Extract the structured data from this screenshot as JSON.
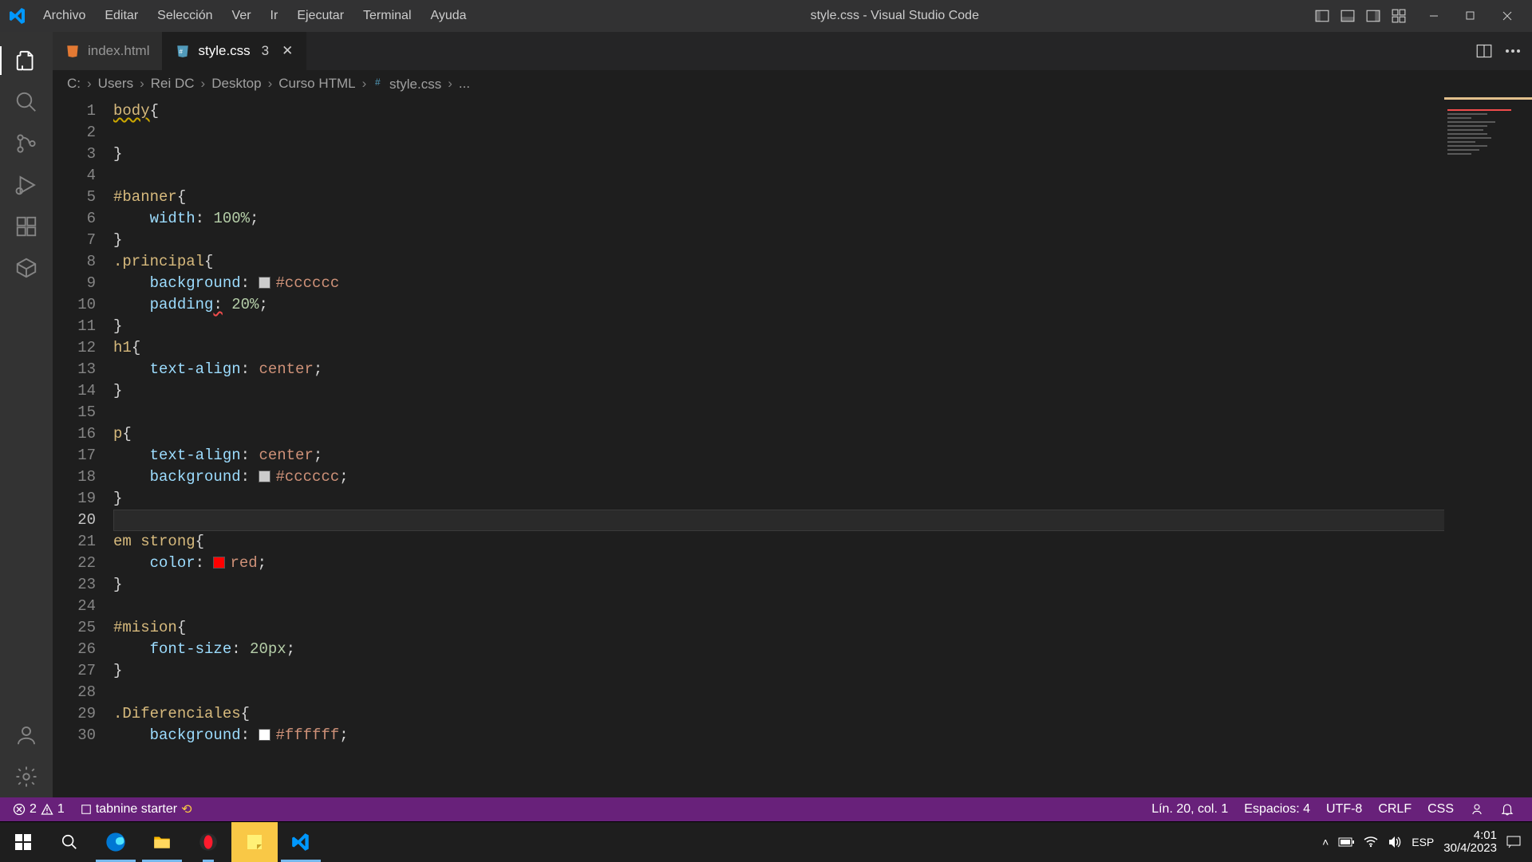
{
  "title_bar": {
    "menus": [
      "Archivo",
      "Editar",
      "Selección",
      "Ver",
      "Ir",
      "Ejecutar",
      "Terminal",
      "Ayuda"
    ],
    "title": "style.css - Visual Studio Code"
  },
  "tabs": [
    {
      "name": "index.html",
      "icon": "html",
      "active": false
    },
    {
      "name": "style.css",
      "icon": "css",
      "active": true,
      "dirty_badge": "3"
    }
  ],
  "breadcrumb": {
    "parts": [
      "C:",
      "Users",
      "Rei DC",
      "Desktop",
      "Curso HTML",
      "style.css",
      "..."
    ],
    "file_index": 5
  },
  "code_lines": [
    {
      "n": 1,
      "html": "<span class='tok-sel wavy'>body</span><span class='tok-punc'>{</span>"
    },
    {
      "n": 2,
      "html": ""
    },
    {
      "n": 3,
      "html": "<span class='tok-punc'>}</span>"
    },
    {
      "n": 4,
      "html": ""
    },
    {
      "n": 5,
      "html": "<span class='tok-sel'>#banner</span><span class='tok-punc'>{</span>"
    },
    {
      "n": 6,
      "html": "    <span class='tok-prop'>width</span><span class='tok-punc'>:</span> <span class='tok-num'>100%</span><span class='tok-punc'>;</span>"
    },
    {
      "n": 7,
      "html": "<span class='tok-punc'>}</span>"
    },
    {
      "n": 8,
      "html": "<span class='tok-sel'>.principal</span><span class='tok-punc'>{</span>"
    },
    {
      "n": 9,
      "html": "    <span class='tok-prop'>background</span><span class='tok-punc'>:</span> <span class='swatch' style='background:#cccccc'></span><span class='tok-val'>#cccccc</span>"
    },
    {
      "n": 10,
      "html": "    <span class='tok-prop'>padding</span><span class='tok-punc wavy-err'>:</span> <span class='tok-num'>20%</span><span class='tok-punc'>;</span>"
    },
    {
      "n": 11,
      "html": "<span class='tok-punc'>}</span>"
    },
    {
      "n": 12,
      "html": "<span class='tok-sel'>h1</span><span class='tok-punc'>{</span>"
    },
    {
      "n": 13,
      "html": "    <span class='tok-prop'>text-align</span><span class='tok-punc'>:</span> <span class='tok-val'>center</span><span class='tok-punc'>;</span>"
    },
    {
      "n": 14,
      "html": "<span class='tok-punc'>}</span>"
    },
    {
      "n": 15,
      "html": ""
    },
    {
      "n": 16,
      "html": "<span class='tok-sel'>p</span><span class='tok-punc'>{</span>"
    },
    {
      "n": 17,
      "html": "    <span class='tok-prop'>text-align</span><span class='tok-punc'>:</span> <span class='tok-val'>center</span><span class='tok-punc'>;</span>"
    },
    {
      "n": 18,
      "html": "    <span class='tok-prop'>background</span><span class='tok-punc'>:</span> <span class='swatch' style='background:#cccccc'></span><span class='tok-val'>#cccccc</span><span class='tok-punc'>;</span>"
    },
    {
      "n": 19,
      "html": "<span class='tok-punc'>}</span>"
    },
    {
      "n": 20,
      "html": "",
      "current": true
    },
    {
      "n": 21,
      "html": "<span class='tok-sel'>em strong</span><span class='tok-punc'>{</span>"
    },
    {
      "n": 22,
      "html": "    <span class='tok-prop'>color</span><span class='tok-punc'>:</span> <span class='swatch' style='background:red'></span><span class='tok-val'>red</span><span class='tok-punc'>;</span>"
    },
    {
      "n": 23,
      "html": "<span class='tok-punc'>}</span>"
    },
    {
      "n": 24,
      "html": ""
    },
    {
      "n": 25,
      "html": "<span class='tok-sel'>#mision</span><span class='tok-punc'>{</span>"
    },
    {
      "n": 26,
      "html": "    <span class='tok-prop'>font-size</span><span class='tok-punc'>:</span> <span class='tok-num'>20px</span><span class='tok-punc'>;</span>"
    },
    {
      "n": 27,
      "html": "<span class='tok-punc'>}</span>"
    },
    {
      "n": 28,
      "html": ""
    },
    {
      "n": 29,
      "html": "<span class='tok-sel'>.Diferenciales</span><span class='tok-punc'>{</span>"
    },
    {
      "n": 30,
      "html": "    <span class='tok-prop'>background</span><span class='tok-punc'>:</span> <span class='swatch' style='background:#ffffff'></span><span class='tok-val'>#ffffff</span><span class='tok-punc'>;</span>"
    }
  ],
  "status_bar": {
    "errors": "2",
    "warnings": "1",
    "tabnine": "tabnine starter",
    "position": "Lín. 20, col. 1",
    "spaces": "Espacios: 4",
    "encoding": "UTF-8",
    "eol": "CRLF",
    "lang": "CSS"
  },
  "taskbar": {
    "time": "4:01",
    "date": "30/4/2023",
    "input_lang": "ESP"
  }
}
